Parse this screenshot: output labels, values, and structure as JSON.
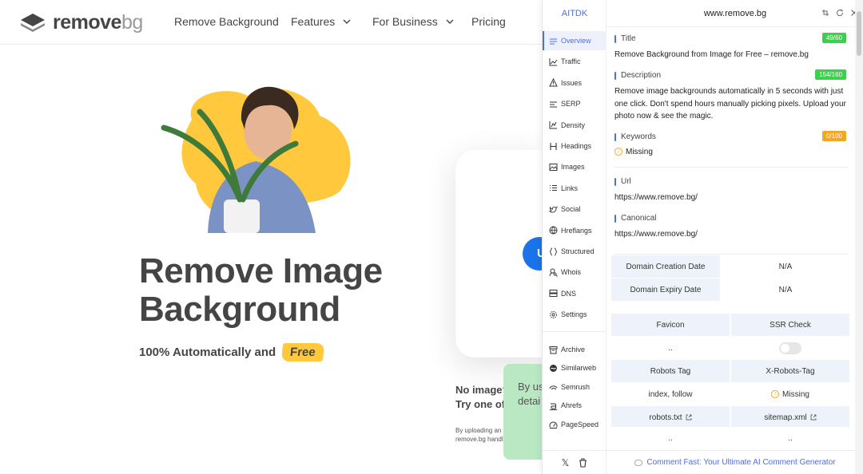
{
  "site": {
    "logo_main": "remove",
    "logo_bg": "bg",
    "nav": [
      "Remove Background",
      "Features",
      "For Business",
      "Pricing"
    ],
    "hero_title_1": "Remove Image",
    "hero_title_2": "Background",
    "hero_sub": "100% Automatically and",
    "hero_free": "Free",
    "no_image_1": "No image?",
    "no_image_2": "Try one of",
    "terms_1": "By uploading an",
    "terms_2": "remove.bg handl",
    "green_1": "By us",
    "green_2": "detai",
    "colors": {
      "accent_yellow": "#ffc83d",
      "upload_blue": "#1a73e8"
    }
  },
  "panel": {
    "brand": "AITDK",
    "url": "www.remove.bg",
    "sidebar": [
      {
        "label": "Overview",
        "icon": "menu-icon",
        "active": true
      },
      {
        "label": "Traffic",
        "icon": "chart-line-icon"
      },
      {
        "label": "Issues",
        "icon": "warning-icon"
      },
      {
        "label": "SERP",
        "icon": "serp-icon"
      },
      {
        "label": "Density",
        "icon": "chart-icon"
      },
      {
        "label": "Headings",
        "icon": "heading-icon"
      },
      {
        "label": "Images",
        "icon": "image-icon"
      },
      {
        "label": "Links",
        "icon": "list-icon"
      },
      {
        "label": "Social",
        "icon": "twitter-icon"
      },
      {
        "label": "Hreflangs",
        "icon": "globe-icon"
      },
      {
        "label": "Structured",
        "icon": "braces-icon"
      },
      {
        "label": "Whois",
        "icon": "user-search-icon"
      },
      {
        "label": "DNS",
        "icon": "server-icon"
      },
      {
        "label": "Settings",
        "icon": "gear-icon"
      }
    ],
    "sidebar_tools": [
      {
        "label": "Archive",
        "icon": "archive-icon"
      },
      {
        "label": "Similarweb",
        "icon": "similarweb-icon"
      },
      {
        "label": "Semrush",
        "icon": "semrush-icon"
      },
      {
        "label": "Ahrefs",
        "icon": "ahrefs-icon"
      },
      {
        "label": "PageSpeed",
        "icon": "speed-icon"
      }
    ],
    "title_label": "Title",
    "title_badge": "49/60",
    "title_value": "Remove Background from Image for Free – remove.bg",
    "desc_label": "Description",
    "desc_badge": "154/160",
    "desc_value": "Remove image backgrounds automatically in 5 seconds with just one click. Don't spend hours manually picking pixels. Upload your photo now & see the magic.",
    "keywords_label": "Keywords",
    "keywords_badge": "0/100",
    "keywords_value": "Missing",
    "url_label": "Url",
    "url_value": "https://www.remove.bg/",
    "canonical_label": "Canonical",
    "canonical_value": "https://www.remove.bg/",
    "domain_creation_label": "Domain Creation Date",
    "domain_creation_value": "N/A",
    "domain_expiry_label": "Domain Expiry Date",
    "domain_expiry_value": "N/A",
    "favicon_label": "Favicon",
    "favicon_value": "..",
    "ssr_label": "SSR Check",
    "robots_tag_label": "Robots Tag",
    "robots_tag_value": "index, follow",
    "x_robots_label": "X-Robots-Tag",
    "x_robots_value": "Missing",
    "robots_txt_label": "robots.txt",
    "robots_txt_value": "..",
    "sitemap_label": "sitemap.xml",
    "sitemap_value": "..",
    "footer_text": "Comment Fast: Your Ultimate AI Comment Generator",
    "colors": {
      "accent": "#4a6cf7",
      "ok": "#3ecf4f",
      "warn": "#f5a623"
    }
  }
}
